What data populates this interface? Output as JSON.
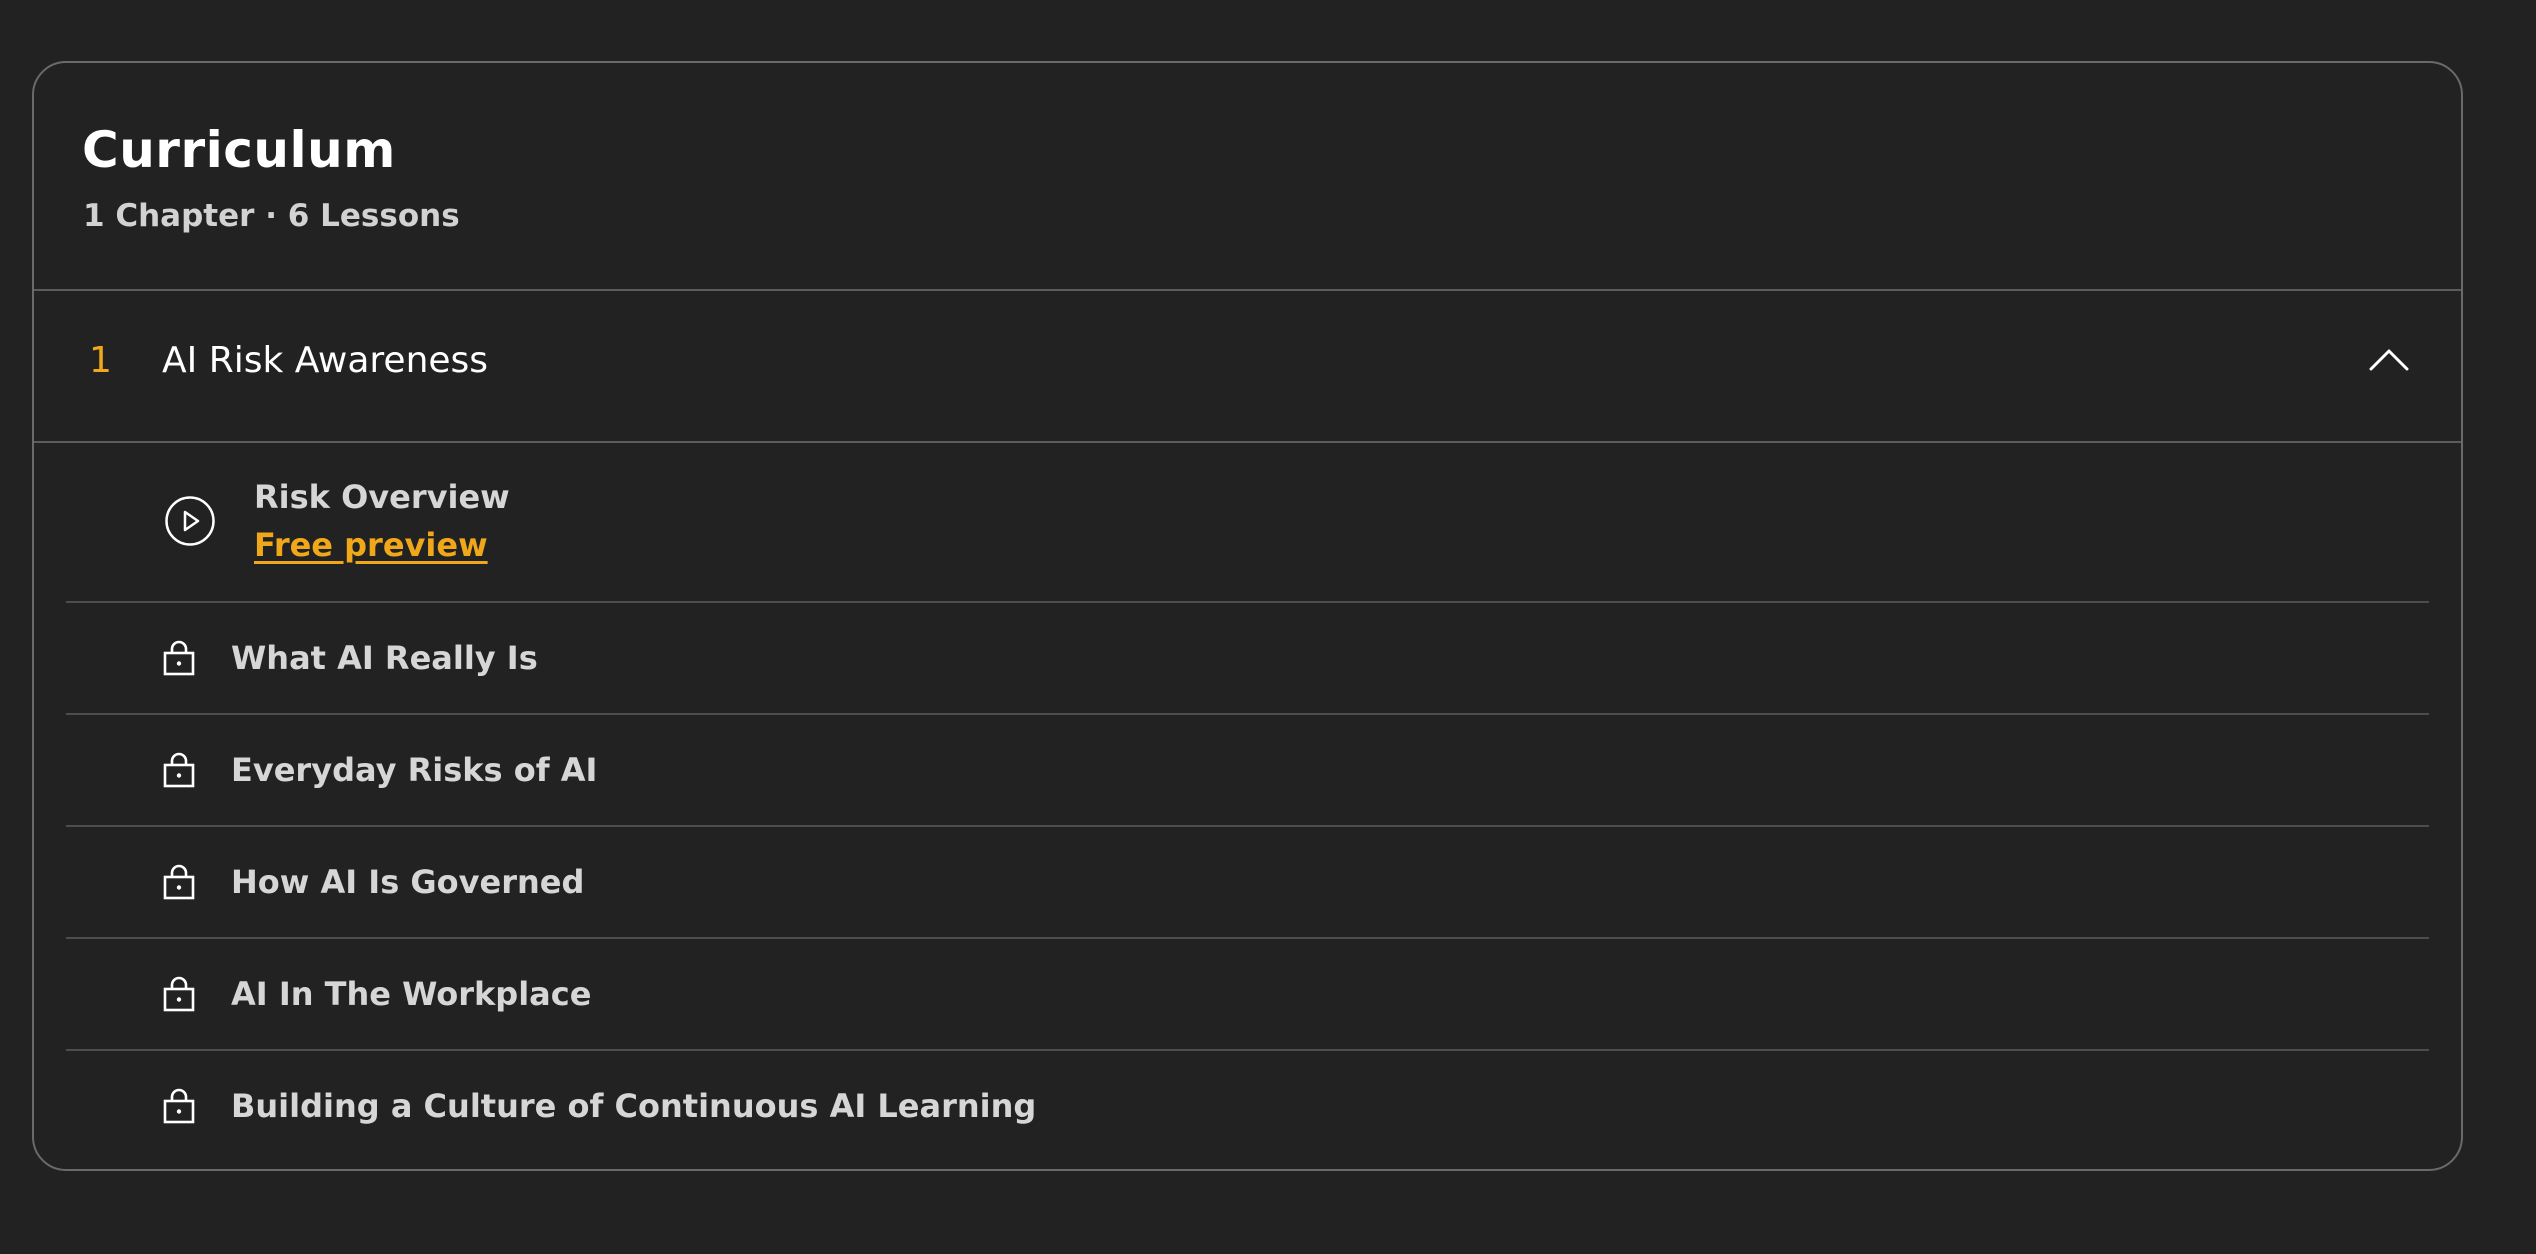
{
  "curriculum": {
    "title": "Curriculum",
    "summary": "1 Chapter · 6 Lessons"
  },
  "chapter": {
    "number": "1",
    "title": "AI Risk Awareness",
    "expanded": true,
    "toggle_icon": "chevron-up-icon"
  },
  "lessons": [
    {
      "label": "Risk Overview",
      "icon": "play-circle-icon",
      "preview_label": "Free preview",
      "locked": false
    },
    {
      "label": "What AI Really Is",
      "icon": "lock-icon",
      "locked": true
    },
    {
      "label": "Everyday Risks of AI",
      "icon": "lock-icon",
      "locked": true
    },
    {
      "label": "How AI Is Governed",
      "icon": "lock-icon",
      "locked": true
    },
    {
      "label": "AI In The Workplace",
      "icon": "lock-icon",
      "locked": true
    },
    {
      "label": "Building a Culture of Continuous AI Learning",
      "icon": "lock-icon",
      "locked": true
    }
  ],
  "colors": {
    "background": "#222222",
    "accent": "#f0a81a",
    "border": "#6a6a6a",
    "text_primary": "#ffffff",
    "text_secondary": "#d6d6d6"
  }
}
